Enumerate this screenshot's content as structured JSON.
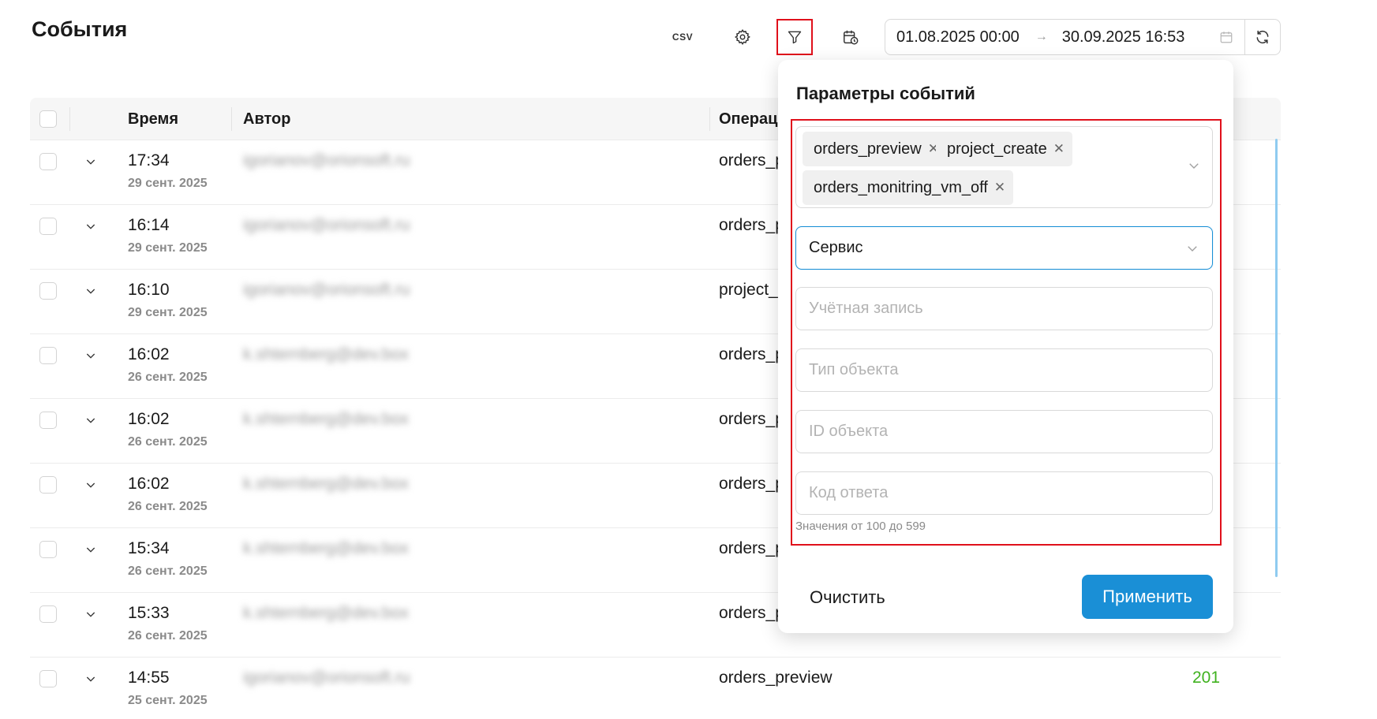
{
  "page": {
    "title": "События"
  },
  "toolbar": {
    "csv_label": "CSV",
    "settings_icon": "gear-icon",
    "filter_icon": "filter-icon",
    "history_icon": "calendar-clock-icon",
    "date_from": "01.08.2025 00:00",
    "date_arrow": "→",
    "date_to": "30.09.2025 16:53",
    "refresh_icon": "refresh-icon"
  },
  "table": {
    "columns": [
      "Время",
      "Автор",
      "Операц"
    ],
    "rows": [
      {
        "time": "17:34",
        "date": "29 сент. 2025",
        "author": "igorianov@orionsoft.ru",
        "operation": "orders_p",
        "code": ""
      },
      {
        "time": "16:14",
        "date": "29 сент. 2025",
        "author": "igorianov@orionsoft.ru",
        "operation": "orders_p",
        "code": ""
      },
      {
        "time": "16:10",
        "date": "29 сент. 2025",
        "author": "igorianov@orionsoft.ru",
        "operation": "project_",
        "code": ""
      },
      {
        "time": "16:02",
        "date": "26 сент. 2025",
        "author": "k.shternberg@dev.box",
        "operation": "orders_p",
        "code": ""
      },
      {
        "time": "16:02",
        "date": "26 сент. 2025",
        "author": "k.shternberg@dev.box",
        "operation": "orders_p",
        "code": ""
      },
      {
        "time": "16:02",
        "date": "26 сент. 2025",
        "author": "k.shternberg@dev.box",
        "operation": "orders_p",
        "code": ""
      },
      {
        "time": "15:34",
        "date": "26 сент. 2025",
        "author": "k.shternberg@dev.box",
        "operation": "orders_p",
        "code": ""
      },
      {
        "time": "15:33",
        "date": "26 сент. 2025",
        "author": "k.shternberg@dev.box",
        "operation": "orders_p",
        "code": ""
      },
      {
        "time": "14:55",
        "date": "25 сент. 2025",
        "author": "igorianov@orionsoft.ru",
        "operation": "orders_preview",
        "code": "201"
      }
    ]
  },
  "filter_popover": {
    "title": "Параметры событий",
    "operations": [
      "orders_preview",
      "project_create",
      "orders_monitring_vm_off"
    ],
    "service_value": "Сервис",
    "account_placeholder": "Учётная запись",
    "object_type_placeholder": "Тип объекта",
    "object_id_placeholder": "ID объекта",
    "response_code_placeholder": "Код ответа",
    "response_code_hint": "Значения от 100 до 599",
    "clear_label": "Очистить",
    "apply_label": "Применить"
  },
  "colors": {
    "accent": "#1a8fd6",
    "highlight": "#e0101b",
    "success": "#3fb21f"
  }
}
